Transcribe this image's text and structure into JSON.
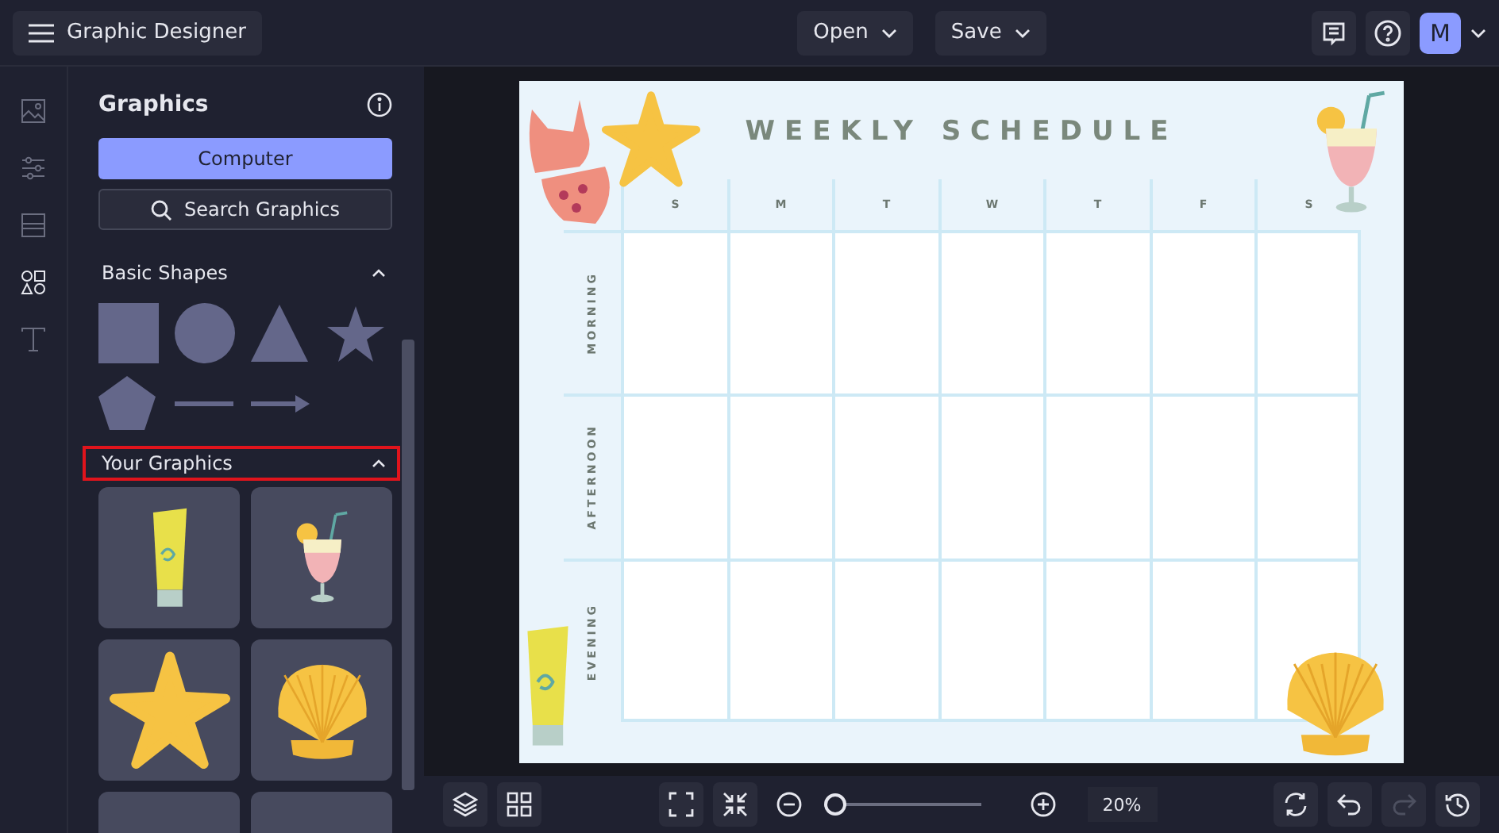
{
  "app": {
    "title": "Graphic Designer"
  },
  "toolbar": {
    "buttons": [
      {
        "label": "Open"
      },
      {
        "label": "Save"
      }
    ],
    "avatar": "M"
  },
  "rail": [
    {
      "kind": "image",
      "selected": false
    },
    {
      "kind": "sliders",
      "selected": false
    },
    {
      "kind": "layout",
      "selected": false
    },
    {
      "kind": "shapes",
      "selected": true
    },
    {
      "kind": "text",
      "selected": false
    }
  ],
  "panel": {
    "title": "Graphics",
    "primary_button": "Computer",
    "search_button": "Search Graphics",
    "sections": [
      {
        "title": "Basic Shapes",
        "expanded": true,
        "highlighted": false,
        "items": [
          {
            "kind": "square"
          },
          {
            "kind": "circle"
          },
          {
            "kind": "triangle"
          },
          {
            "kind": "star"
          },
          {
            "kind": "pentagon"
          },
          {
            "kind": "line"
          },
          {
            "kind": "arrow"
          }
        ]
      },
      {
        "title": "Your Graphics",
        "expanded": true,
        "highlighted": true,
        "items": [
          {
            "kind": "sunscreen"
          },
          {
            "kind": "cocktail"
          },
          {
            "kind": "starfish"
          },
          {
            "kind": "shell"
          },
          {
            "kind": "cropped"
          },
          {
            "kind": "cropped"
          }
        ]
      }
    ]
  },
  "schedule": {
    "title": "WEEKLY SCHEDULE",
    "days": [
      "S",
      "M",
      "T",
      "W",
      "T",
      "F",
      "S"
    ],
    "periods": [
      "MORNING",
      "AFTERNOON",
      "EVENING"
    ]
  },
  "bottom_bar": {
    "zoom": {
      "level": 0.03,
      "reading": "20%"
    },
    "redo_disabled": true
  }
}
